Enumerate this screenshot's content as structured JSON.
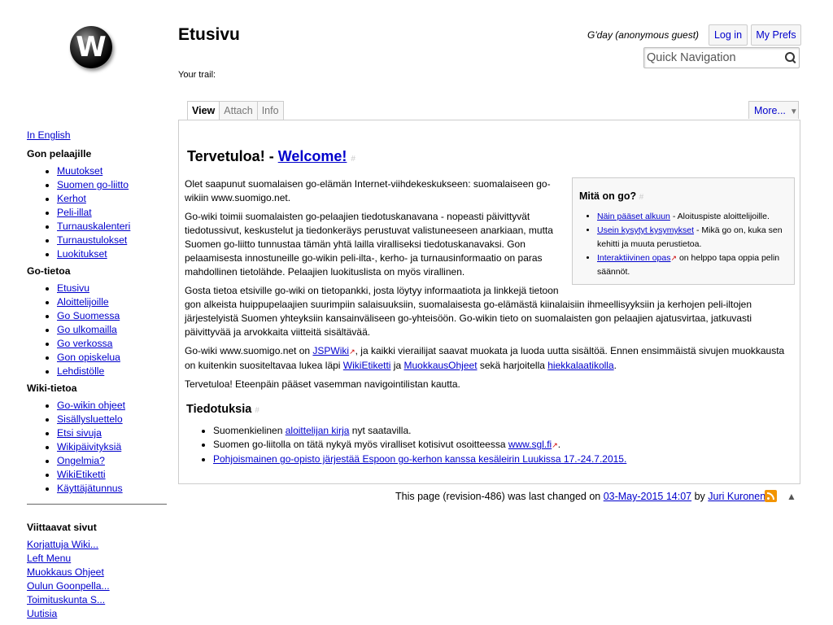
{
  "header": {
    "page_title": "Etusivu",
    "trail_label": "Your trail:",
    "greeting": "G'day (anonymous guest)",
    "login_label": "Log in",
    "prefs_label": "My Prefs",
    "search_placeholder": "Quick Navigation",
    "search_icon": "magnifier-icon",
    "logo": "W"
  },
  "tabs": [
    {
      "label": "View",
      "active": true
    },
    {
      "label": "Attach",
      "active": false
    },
    {
      "label": "Info",
      "active": false
    }
  ],
  "more_label": "More...",
  "sidebar": {
    "lang_link": "In English",
    "sections": [
      {
        "title": "Gon pelaajille",
        "items": [
          "Muutokset",
          "Suomen go-liitto",
          "Kerhot",
          "Peli-illat",
          "Turnauskalenteri",
          "Turnaustulokset",
          "Luokitukset"
        ]
      },
      {
        "title": "Go-tietoa",
        "items": [
          "Etusivu",
          "Aloittelijoille",
          "Go Suomessa",
          "Go ulkomailla",
          "Go verkossa",
          "Gon opiskelua",
          "Lehdistölle"
        ]
      },
      {
        "title": "Wiki-tietoa",
        "items": [
          "Go-wikin ohjeet",
          "Sisällysluettelo",
          "Etsi sivuja",
          "Wikipäivityksiä",
          "Ongelmia?",
          "WikiEtiketti",
          "Käyttäjätunnus"
        ]
      }
    ],
    "related_title": "Viittaavat sivut",
    "related": [
      "Korjattuja Wiki...",
      "Left Menu",
      "Muokkaus Ohjeet",
      "Oulun Goonpella...",
      "Toimituskunta S...",
      "Uutisia"
    ]
  },
  "content": {
    "heading_prefix": "Tervetuloa! - ",
    "heading_link": "Welcome!",
    "sidebox": {
      "title": "Mitä on go?",
      "items": [
        {
          "link": "Näin pääset alkuun",
          "text": " - Aloituspiste aloittelijoille."
        },
        {
          "link": "Usein kysytyt kysymykset",
          "text": " - Mikä go on, kuka sen kehitti ja muuta perustietoa."
        },
        {
          "link": "Interaktiivinen opas",
          "text": " on helppo tapa oppia pelin säännöt."
        }
      ]
    },
    "p1": "Olet saapunut suomalaisen go-elämän Internet-viihdekeskukseen: suomalaiseen go-wikiin www.suomigo.net.",
    "p2": "Go-wiki toimii suomalaisten go-pelaajien tiedotuskanavana - nopeasti päivittyvät tiedotussivut, keskustelut ja tiedonkeräys perustuvat valistuneeseen anarkiaan, mutta Suomen go-liitto tunnustaa tämän yhtä lailla viralliseksi tiedotuskanavaksi. Gon pelaamisesta innostuneille go-wikin peli-ilta-, kerho- ja turnausinformaatio on paras mahdollinen tietolähde. Pelaajien luokituslista on myös virallinen.",
    "p3": "Gosta tietoa etsiville go-wiki on tietopankki, josta löytyy informaatiota ja linkkejä tietoon gon alkeista huippupelaajien suurimpiin salaisuuksiin, suomalaisesta go-elämästä kiinalaisiin ihmeellisyyksiin ja kerhojen peli-iltojen järjestelyistä Suomen yhteyksiin kansainväliseen go-yhteisöön. Go-wikin tieto on suomalaisten gon pelaajien ajatusvirtaa, jatkuvasti päivittyvää ja arvokkaita viitteitä sisältävää.",
    "p4": {
      "t1": "Go-wiki www.suomigo.net on ",
      "l1": "JSPWiki",
      "t2": ", ja kaikki vierailijat saavat muokata ja luoda uutta sisältöä. Ennen ensimmäistä sivujen muokkausta on kuitenkin suositeltavaa lukea läpi ",
      "l2": "WikiEtiketti",
      "t3": " ja ",
      "l3": "MuokkausOhjeet",
      "t4": " sekä harjoitella ",
      "l4": "hiekkalaatikolla",
      "t5": "."
    },
    "p5": "Tervetuloa! Eteenpäin pääset vasemman navigointilistan kautta.",
    "notices_title": "Tiedotuksia",
    "notices": {
      "n1_t1": "Suomenkielinen ",
      "n1_link": "aloittelijan kirja",
      "n1_t2": " nyt saatavilla.",
      "n2_t1": "Suomen go-liitolla on tätä nykyä myös viralliset kotisivut osoitteessa ",
      "n2_link": "www.sgl.fi",
      "n2_t2": ".",
      "n3_link": "Pohjoismainen go-opisto järjestää Espoon go-kerhon kanssa kesäleirin Luukissa 17.-24.7.2015."
    }
  },
  "footer": {
    "text1": "This page (revision-486) was last changed on ",
    "date": "03-May-2015 14:07",
    "text2": " by ",
    "author": "Juri Kuronen",
    "rss_icon": "rss-icon",
    "top_icon": "▲"
  }
}
